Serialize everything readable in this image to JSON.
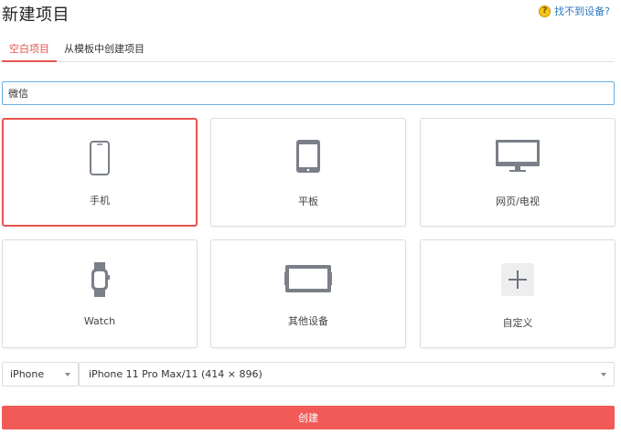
{
  "header": {
    "title": "新建项目",
    "help_link": "找不到设备?",
    "help_icon_glyph": "?"
  },
  "tabs": [
    {
      "label": "空白项目",
      "active": true
    },
    {
      "label": "从模板中创建项目",
      "active": false
    }
  ],
  "search": {
    "value": "微信"
  },
  "devices": [
    {
      "label": "手机",
      "icon": "phone-icon",
      "selected": true
    },
    {
      "label": "平板",
      "icon": "tablet-icon",
      "selected": false
    },
    {
      "label": "网页/电视",
      "icon": "monitor-icon",
      "selected": false
    },
    {
      "label": "Watch",
      "icon": "watch-icon",
      "selected": false
    },
    {
      "label": "其他设备",
      "icon": "other-device-icon",
      "selected": false
    },
    {
      "label": "自定义",
      "icon": "plus-icon",
      "selected": false
    }
  ],
  "platform_select": {
    "selected": "iPhone"
  },
  "model_select": {
    "selected": "iPhone 11 Pro Max/11 (414 × 896)"
  },
  "create_button": {
    "label": "创建"
  },
  "colors": {
    "accent": "#e8544f",
    "create_button": "#f25a57",
    "link": "#2f78c4",
    "icon_gray": "#7a7f88"
  }
}
